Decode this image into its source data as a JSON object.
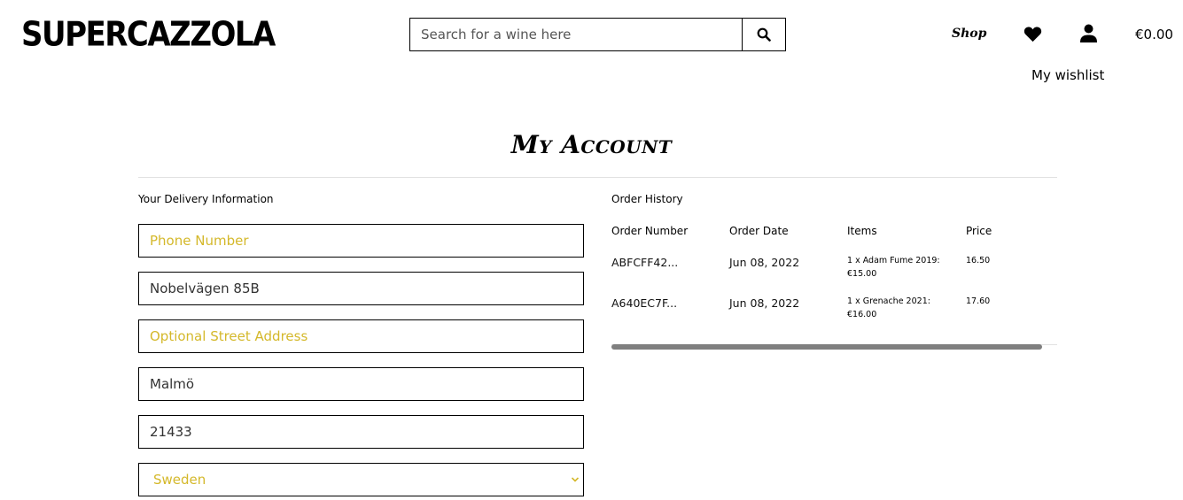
{
  "header": {
    "logo": "SUPERCAZZOLA",
    "search_placeholder": "Search for a wine here",
    "nav_shop": "Shop",
    "cart_total": "€0.00",
    "wishlist_label": "My wishlist",
    "icons": [
      "search-icon",
      "heart-icon",
      "user-icon"
    ]
  },
  "page": {
    "title": "My Account"
  },
  "delivery": {
    "label": "Your Delivery Information",
    "fields": [
      {
        "value": "",
        "placeholder": "Phone Number"
      },
      {
        "value": "Nobelvägen 85B",
        "placeholder": ""
      },
      {
        "value": "",
        "placeholder": "Optional Street Address"
      },
      {
        "value": "Malmö",
        "placeholder": ""
      },
      {
        "value": "21433",
        "placeholder": ""
      }
    ],
    "country": "Sweden"
  },
  "order_history": {
    "label": "Order History",
    "columns": [
      "Order Number",
      "Order Date",
      "Items",
      "Price"
    ],
    "rows": [
      {
        "number": "ABFCFF42...",
        "date": "Jun 08, 2022",
        "item": "1 x Adam Fume 2019:",
        "item_price": "€15.00",
        "price": "16.50"
      },
      {
        "number": "A640EC7F...",
        "date": "Jun 08, 2022",
        "item": "1 x Grenache 2021:",
        "item_price": "€16.00",
        "price": "17.60"
      }
    ]
  },
  "colors": {
    "accent": "#d4b82a",
    "border": "#000000",
    "rule": "#e2e2e2",
    "scrollbar": "#7f7f7f"
  }
}
